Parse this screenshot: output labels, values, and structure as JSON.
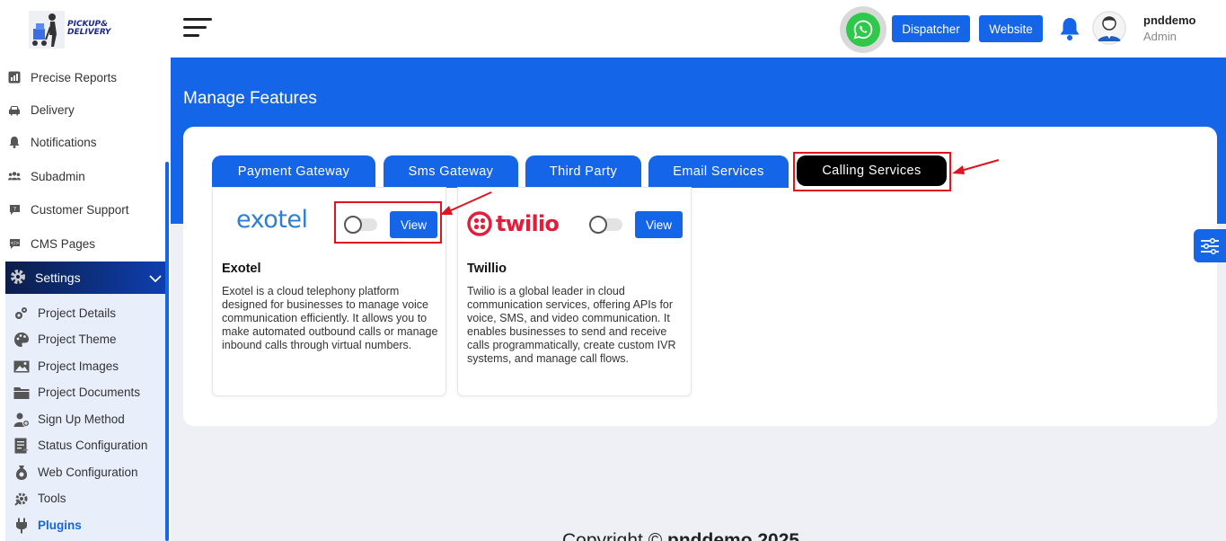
{
  "brand": {
    "logo_line1": "PICKUP&",
    "logo_line2": "DELIVERY"
  },
  "sidebar": {
    "items": [
      {
        "label": "Precise Reports",
        "icon": "report-icon"
      },
      {
        "label": "Delivery",
        "icon": "car-icon"
      },
      {
        "label": "Notifications",
        "icon": "bell-icon"
      },
      {
        "label": "Subadmin",
        "icon": "users-icon"
      },
      {
        "label": "Customer Support",
        "icon": "support-icon"
      },
      {
        "label": "CMS Pages",
        "icon": "cms-icon"
      }
    ],
    "settings_label": "Settings",
    "submenu": [
      {
        "label": "Project Details",
        "icon": "project-details-icon"
      },
      {
        "label": "Project Theme",
        "icon": "palette-icon"
      },
      {
        "label": "Project Images",
        "icon": "image-icon"
      },
      {
        "label": "Project Documents",
        "icon": "folder-icon"
      },
      {
        "label": "Sign Up Method",
        "icon": "signup-icon"
      },
      {
        "label": "Status Configuration",
        "icon": "status-icon"
      },
      {
        "label": "Web Configuration",
        "icon": "web-config-icon"
      },
      {
        "label": "Tools",
        "icon": "tools-icon"
      },
      {
        "label": "Plugins",
        "icon": "plug-icon"
      }
    ]
  },
  "header": {
    "dispatcher_label": "Dispatcher",
    "website_label": "Website",
    "user_name": "pnddemo",
    "user_role": "Admin"
  },
  "page": {
    "title": "Manage Features"
  },
  "tabs": [
    {
      "label": "Payment Gateway"
    },
    {
      "label": "Sms Gateway"
    },
    {
      "label": "Third Party"
    },
    {
      "label": "Email Services"
    },
    {
      "label": "Calling Services",
      "active": true
    }
  ],
  "cards": [
    {
      "logo_text": "exotel",
      "view_label": "View",
      "name": "Exotel",
      "enabled": false,
      "description": "Exotel is a cloud telephony platform designed for businesses to manage voice communication efficiently. It allows you to make automated outbound calls or manage inbound calls through virtual numbers."
    },
    {
      "logo_text": "twilio",
      "view_label": "View",
      "name": "Twillio",
      "enabled": false,
      "description": "Twilio is a global leader in cloud communication services, offering APIs for voice, SMS, and video communication. It enables businesses to send and receive calls programmatically, create custom IVR systems, and manage call flows."
    }
  ],
  "footer": {
    "text_prefix": "Copyright © ",
    "text_bold": "pnddemo 2025"
  },
  "colors": {
    "primary": "#1565e8",
    "highlight": "#e0141e",
    "twilio": "#e31e3b",
    "whatsapp": "#2ec84b"
  }
}
